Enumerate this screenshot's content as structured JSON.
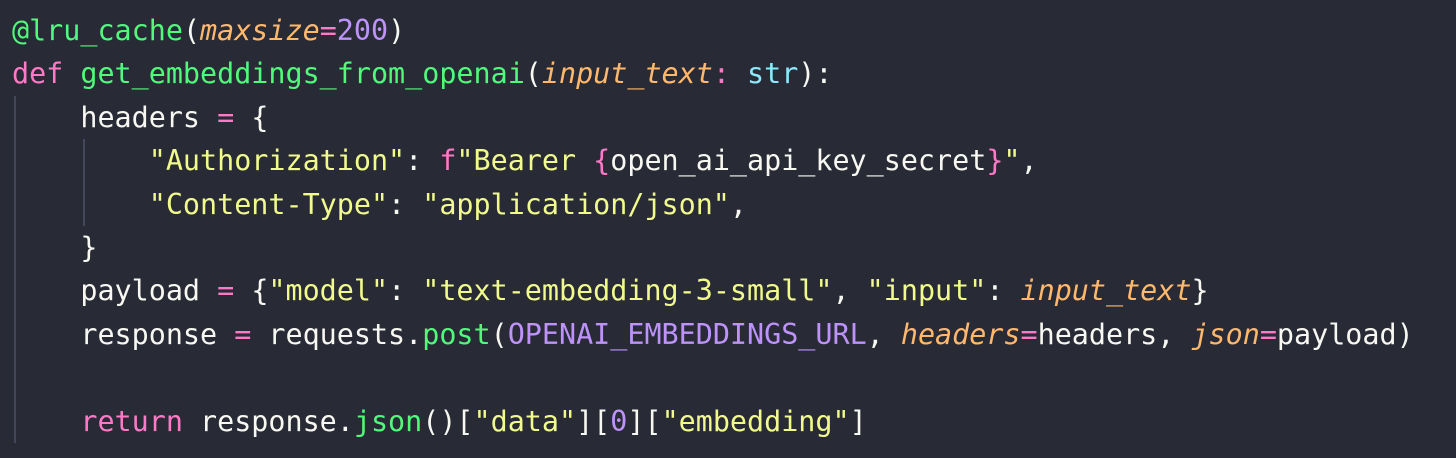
{
  "theme": {
    "background": "#282a36",
    "foreground": "#f8f8f2",
    "pink": "#ff79c6",
    "green": "#50fa7b",
    "orange": "#ffb86c",
    "purple": "#bd93f9",
    "cyan": "#8be9fd",
    "yellow": "#f1fa8c",
    "indent_guide": "#44475a"
  },
  "code": {
    "lines": [
      {
        "indent": 0,
        "guides": 0,
        "tokens": [
          {
            "t": "@lru_cache",
            "c": "dec"
          },
          {
            "t": "(",
            "c": "plain"
          },
          {
            "t": "maxsize",
            "c": "param"
          },
          {
            "t": "=",
            "c": "op"
          },
          {
            "t": "200",
            "c": "num"
          },
          {
            "t": ")",
            "c": "plain"
          }
        ]
      },
      {
        "indent": 0,
        "guides": 0,
        "tokens": [
          {
            "t": "def",
            "c": "kw"
          },
          {
            "t": " ",
            "c": "plain"
          },
          {
            "t": "get_embeddings_from_openai",
            "c": "fn"
          },
          {
            "t": "(",
            "c": "plain"
          },
          {
            "t": "input_text",
            "c": "param"
          },
          {
            "t": ": ",
            "c": "op"
          },
          {
            "t": "str",
            "c": "type"
          },
          {
            "t": "):",
            "c": "plain"
          }
        ]
      },
      {
        "indent": 1,
        "guides": 1,
        "tokens": [
          {
            "t": "headers",
            "c": "plain"
          },
          {
            "t": " = ",
            "c": "op"
          },
          {
            "t": "{",
            "c": "plain"
          }
        ]
      },
      {
        "indent": 2,
        "guides": 2,
        "tokens": [
          {
            "t": "\"Authorization\"",
            "c": "str"
          },
          {
            "t": ": ",
            "c": "plain"
          },
          {
            "t": "f",
            "c": "kw"
          },
          {
            "t": "\"Bearer ",
            "c": "str"
          },
          {
            "t": "{",
            "c": "kw"
          },
          {
            "t": "open_ai_api_key_secret",
            "c": "plain"
          },
          {
            "t": "}",
            "c": "kw"
          },
          {
            "t": "\"",
            "c": "str"
          },
          {
            "t": ",",
            "c": "plain"
          }
        ]
      },
      {
        "indent": 2,
        "guides": 2,
        "tokens": [
          {
            "t": "\"Content-Type\"",
            "c": "str"
          },
          {
            "t": ": ",
            "c": "plain"
          },
          {
            "t": "\"application/json\"",
            "c": "str"
          },
          {
            "t": ",",
            "c": "plain"
          }
        ]
      },
      {
        "indent": 1,
        "guides": 1,
        "tokens": [
          {
            "t": "}",
            "c": "plain"
          }
        ]
      },
      {
        "indent": 1,
        "guides": 1,
        "tokens": [
          {
            "t": "payload",
            "c": "plain"
          },
          {
            "t": " = ",
            "c": "op"
          },
          {
            "t": "{",
            "c": "plain"
          },
          {
            "t": "\"model\"",
            "c": "str"
          },
          {
            "t": ": ",
            "c": "plain"
          },
          {
            "t": "\"text-embedding-3-small\"",
            "c": "str"
          },
          {
            "t": ", ",
            "c": "plain"
          },
          {
            "t": "\"input\"",
            "c": "str"
          },
          {
            "t": ": ",
            "c": "plain"
          },
          {
            "t": "input_text",
            "c": "param"
          },
          {
            "t": "}",
            "c": "plain"
          }
        ]
      },
      {
        "indent": 1,
        "guides": 1,
        "tokens": [
          {
            "t": "response",
            "c": "plain"
          },
          {
            "t": " = ",
            "c": "op"
          },
          {
            "t": "requests.",
            "c": "plain"
          },
          {
            "t": "post",
            "c": "fn"
          },
          {
            "t": "(",
            "c": "plain"
          },
          {
            "t": "OPENAI_EMBEDDINGS_URL",
            "c": "const"
          },
          {
            "t": ", ",
            "c": "plain"
          },
          {
            "t": "headers",
            "c": "param"
          },
          {
            "t": "=",
            "c": "op"
          },
          {
            "t": "headers",
            "c": "plain"
          },
          {
            "t": ", ",
            "c": "plain"
          },
          {
            "t": "json",
            "c": "param"
          },
          {
            "t": "=",
            "c": "op"
          },
          {
            "t": "payload",
            "c": "plain"
          },
          {
            "t": ")",
            "c": "plain"
          }
        ]
      },
      {
        "indent": 0,
        "guides": 1,
        "tokens": []
      },
      {
        "indent": 1,
        "guides": 1,
        "tokens": [
          {
            "t": "return",
            "c": "kw"
          },
          {
            "t": " response.",
            "c": "plain"
          },
          {
            "t": "json",
            "c": "fn"
          },
          {
            "t": "()[",
            "c": "plain"
          },
          {
            "t": "\"data\"",
            "c": "str"
          },
          {
            "t": "][",
            "c": "plain"
          },
          {
            "t": "0",
            "c": "num"
          },
          {
            "t": "][",
            "c": "plain"
          },
          {
            "t": "\"embedding\"",
            "c": "str"
          },
          {
            "t": "]",
            "c": "plain"
          }
        ]
      }
    ]
  }
}
